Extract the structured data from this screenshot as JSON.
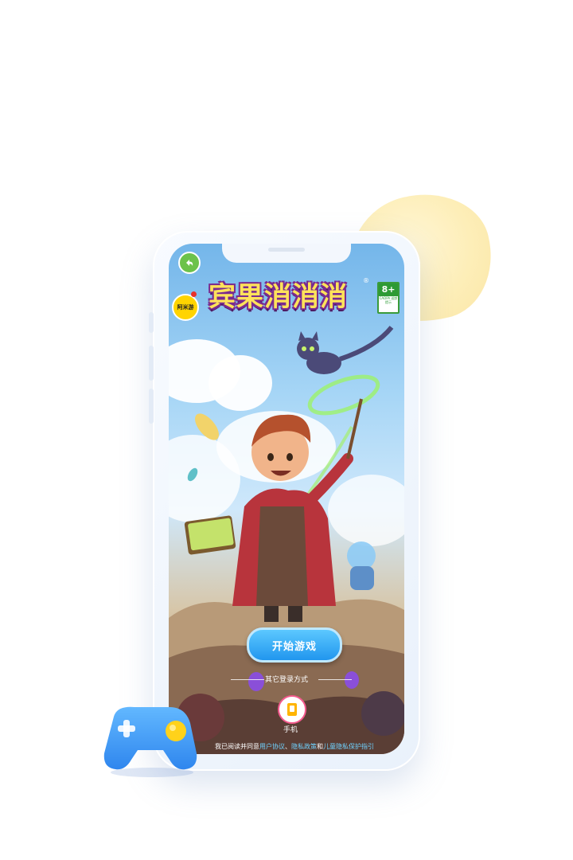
{
  "game": {
    "title": "宾果消消消",
    "trademark": "®",
    "publisher_badge": "阿米游",
    "age_rating": "8+",
    "age_rating_note": "CADPA 适龄提示"
  },
  "main": {
    "start_button": "开始游戏",
    "other_login_label": "其它登录方式",
    "phone_login_label": "手机"
  },
  "agreement": {
    "prefix": "我已阅读并同意",
    "user_agreement": "用户协议",
    "separator": "、",
    "privacy_policy": "隐私政策",
    "and": "和",
    "child_privacy": "儿童隐私保护指引"
  },
  "icons": {
    "back": "back-arrow-icon",
    "phone": "phone-icon",
    "gamepad": "gamepad-icon"
  },
  "colors": {
    "accent": "#2196ee",
    "link": "#6fd2ff",
    "rating_green": "#2d9a34",
    "blob_yellow": "#fdeeb8"
  }
}
